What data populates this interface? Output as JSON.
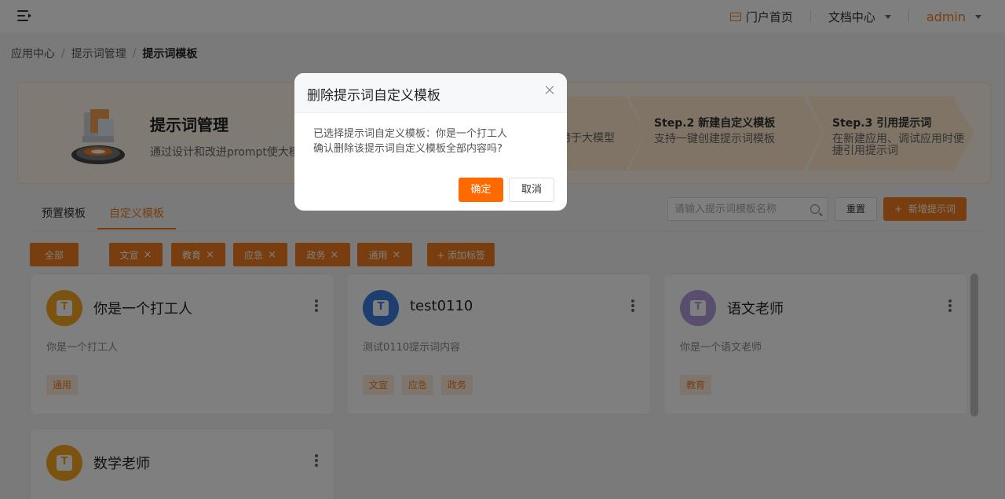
{
  "header": {
    "portal_label": "门户首页",
    "docs_label": "文档中心",
    "user_label": "admin"
  },
  "breadcrumb": [
    "应用中心",
    "提示词管理",
    "提示词模板"
  ],
  "banner": {
    "title": "提示词管理",
    "desc": "通过设计和改进prompt使大模",
    "step1_desc_tail": "用于大模型",
    "step2_title": "Step.2 新建自定义模板",
    "step2_desc": "支持一键创建提示词模板",
    "step3_title": "Step.3 引用提示词",
    "step3_desc_line1": "在新建应用、调试应用时便",
    "step3_desc_line2": "捷引用提示词"
  },
  "tabs": [
    {
      "label": "预置模板",
      "active": false
    },
    {
      "label": "自定义模板",
      "active": true
    }
  ],
  "search": {
    "placeholder": "请输入提示词模板名称"
  },
  "toolbar": {
    "reset_label": "重置",
    "add_label": "新增提示词"
  },
  "tag_filters": {
    "all_label": "全部",
    "tags": [
      "文宣",
      "教育",
      "应急",
      "政务",
      "通用"
    ],
    "add_tag_label": "+ 添加标签"
  },
  "cards": [
    {
      "title": "你是一个打工人",
      "desc": "你是一个打工人",
      "tags": [
        "通用"
      ],
      "avatar_color": "#f5a623"
    },
    {
      "title": "test0110",
      "desc": "测试0110提示词内容",
      "tags": [
        "文宣",
        "应急",
        "政务"
      ],
      "avatar_color": "#3b7ddd"
    },
    {
      "title": "语文老师",
      "desc": "你是一个语文老师",
      "tags": [
        "教育"
      ],
      "avatar_color": "#b39ddb"
    },
    {
      "title": "数学老师",
      "desc": "",
      "tags": [],
      "avatar_color": "#f5a623"
    }
  ],
  "modal": {
    "title": "删除提示词自定义模板",
    "line1": "已选择提示词自定义模板：你是一个打工人",
    "line2": "确认删除该提示词自定义模板全部内容吗?",
    "ok_label": "确定",
    "cancel_label": "取消"
  },
  "colors": {
    "accent": "#f07c1e",
    "danger_ok": "#ff6a00"
  }
}
